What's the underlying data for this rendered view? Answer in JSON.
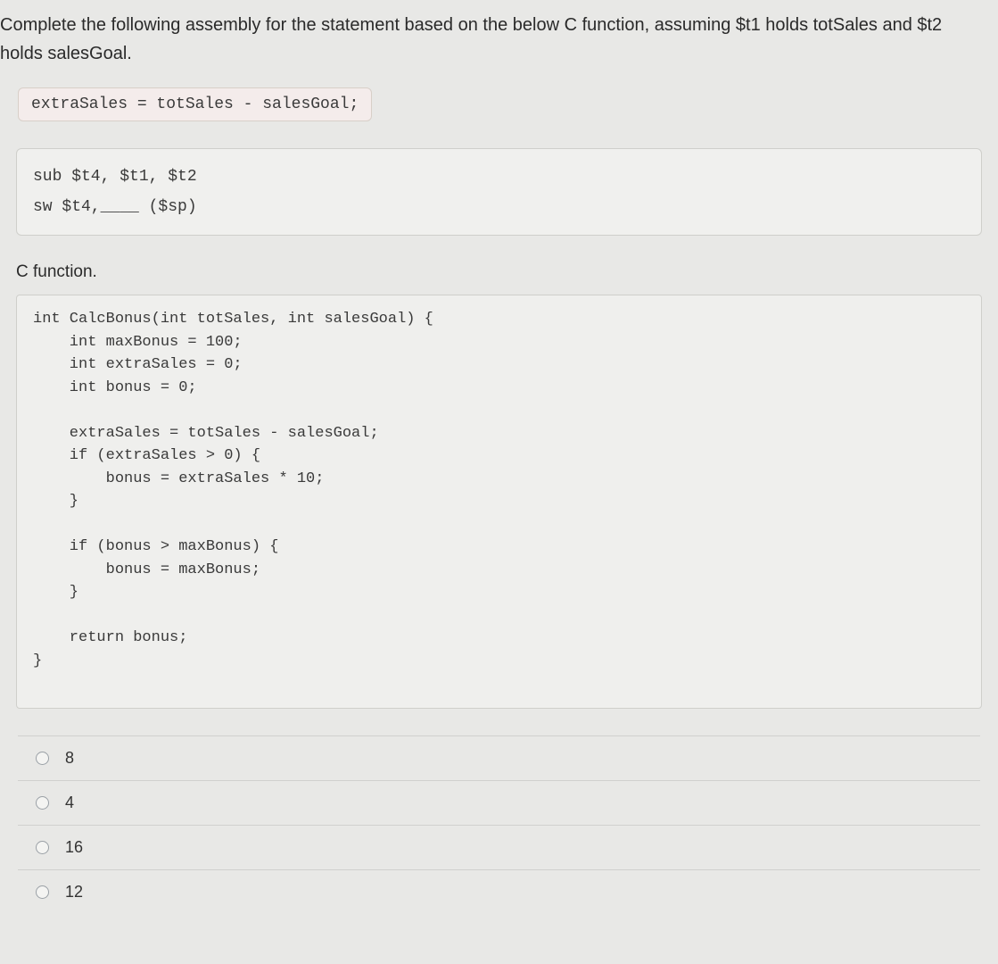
{
  "question": {
    "prompt": "Complete the following assembly for the statement based on the below C function, assuming $t1 holds totSales and $t2 holds salesGoal."
  },
  "statement_code": "extraSales = totSales - salesGoal;",
  "assembly_code": "sub $t4, $t1, $t2\nsw $t4,____ ($sp)",
  "c_function_heading": "C function.",
  "c_code": "int CalcBonus(int totSales, int salesGoal) {\n    int maxBonus = 100;\n    int extraSales = 0;\n    int bonus = 0;\n\n    extraSales = totSales - salesGoal;\n    if (extraSales > 0) {\n        bonus = extraSales * 10;\n    }\n\n    if (bonus > maxBonus) {\n        bonus = maxBonus;\n    }\n\n    return bonus;\n}",
  "options": [
    {
      "label": "8"
    },
    {
      "label": "4"
    },
    {
      "label": "16"
    },
    {
      "label": "12"
    }
  ]
}
